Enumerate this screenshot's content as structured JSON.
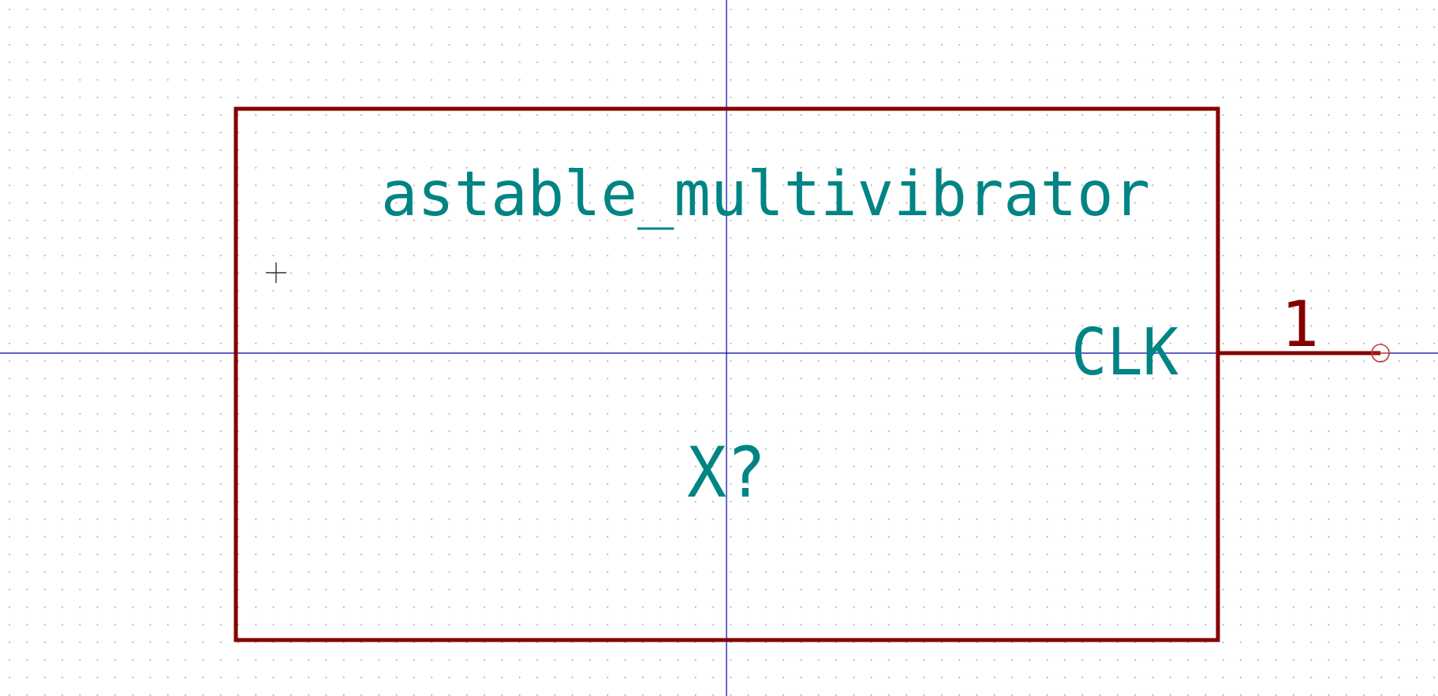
{
  "symbol": {
    "name": "astable_multivibrator",
    "reference": "X?",
    "pins": [
      {
        "name": "CLK",
        "number": "1"
      }
    ]
  },
  "colors": {
    "background": "#ffffff",
    "grid_dot": "#b4b4b4",
    "symbol_body": "#840000",
    "text": "#008484",
    "axis": "#0000b4",
    "pin_end": "#c83232",
    "cursor": "#333333"
  },
  "icons": {
    "anchor": "crosshair-icon",
    "pin_end": "pin-connection-circle-icon"
  }
}
